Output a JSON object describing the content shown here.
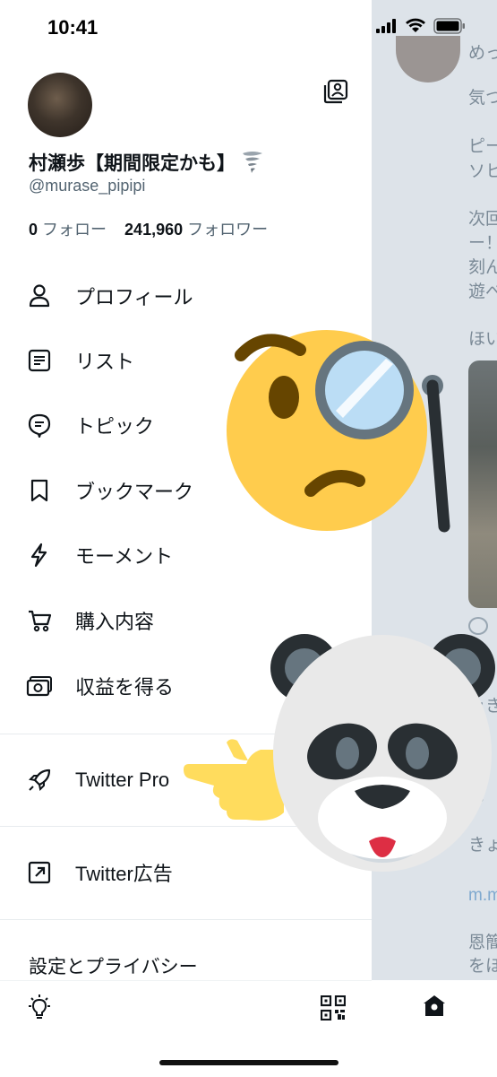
{
  "status_bar": {
    "time": "10:41"
  },
  "profile": {
    "display_name": "村瀬歩【期間限定かも】",
    "handle": "@murase_pipipi",
    "following_count": "0",
    "following_label": "フォロー",
    "followers_count": "241,960",
    "followers_label": "フォロワー"
  },
  "menu": {
    "items": [
      {
        "label": "プロフィール",
        "icon": "person-icon"
      },
      {
        "label": "リスト",
        "icon": "list-icon"
      },
      {
        "label": "トピック",
        "icon": "topic-icon"
      },
      {
        "label": "ブックマーク",
        "icon": "bookmark-icon"
      },
      {
        "label": "モーメント",
        "icon": "lightning-icon"
      },
      {
        "label": "購入内容",
        "icon": "cart-icon"
      },
      {
        "label": "収益を得る",
        "icon": "money-icon"
      }
    ],
    "twitter_pro": "Twitter Pro",
    "twitter_ads": "Twitter広告",
    "settings": "設定とプライバシー"
  },
  "timeline": {
    "lines": [
      "めっ",
      "気つ",
      "ピー",
      "ソヒ",
      "次回",
      "ー！",
      "刻ん",
      "遊べ",
      "ほい",
      "ッき",
      "き",
      "も",
      "きょ",
      "m.m",
      "恩簡",
      "をほ"
    ]
  },
  "colors": {
    "text_primary": "#0f1419",
    "text_secondary": "#536471",
    "timeline_bg": "#dde3e9",
    "emoji_yellow": "#ffcc4d"
  }
}
